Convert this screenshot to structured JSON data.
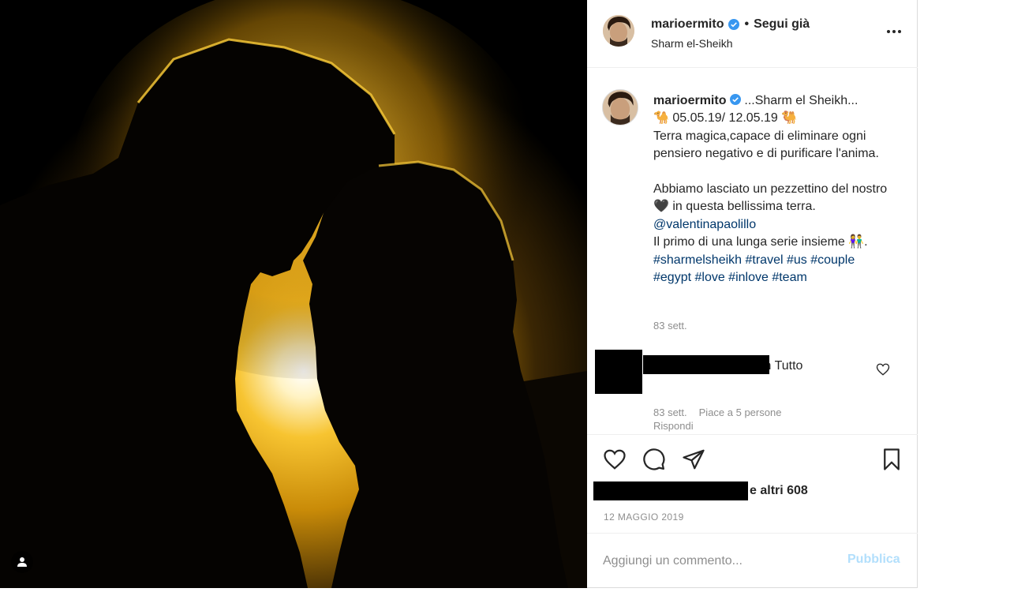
{
  "post": {
    "username": "marioermito",
    "follow_label": "Segui già",
    "separator": "•",
    "location": "Sharm el-Sheikh",
    "caption_title": "...Sharm el Sheikh...",
    "caption_line1": "🐪 05.05.19/ 12.05.19 🐫",
    "caption_line2": "Terra magica,capace di eliminare ogni pensiero negativo e di purificare l'anima.",
    "caption_line3": "Abbiamo lasciato un pezzettino del nostro 🖤 in questa bellissima terra.",
    "mention": "@valentinapaolillo",
    "caption_line4": "Il primo di una lunga serie insieme 👫.",
    "hashtags": "#sharmelsheikh #travel #us #couple #egypt #love #inlove #team",
    "caption_time": "83 sett."
  },
  "comment": {
    "text": "Siete la perfezione in Tutto",
    "time": "83 sett.",
    "likes": "Piace a 5 persone",
    "reply_label": "Rispondi"
  },
  "likes_summary": "e altri 608",
  "date": "12 MAGGIO 2019",
  "composer": {
    "placeholder": "Aggiungi un commento...",
    "publish_label": "Pubblica"
  },
  "colors": {
    "link": "#00376b",
    "verified": "#3897f0",
    "publish_disabled": "#b2dffc",
    "muted": "#8e8e8e"
  }
}
